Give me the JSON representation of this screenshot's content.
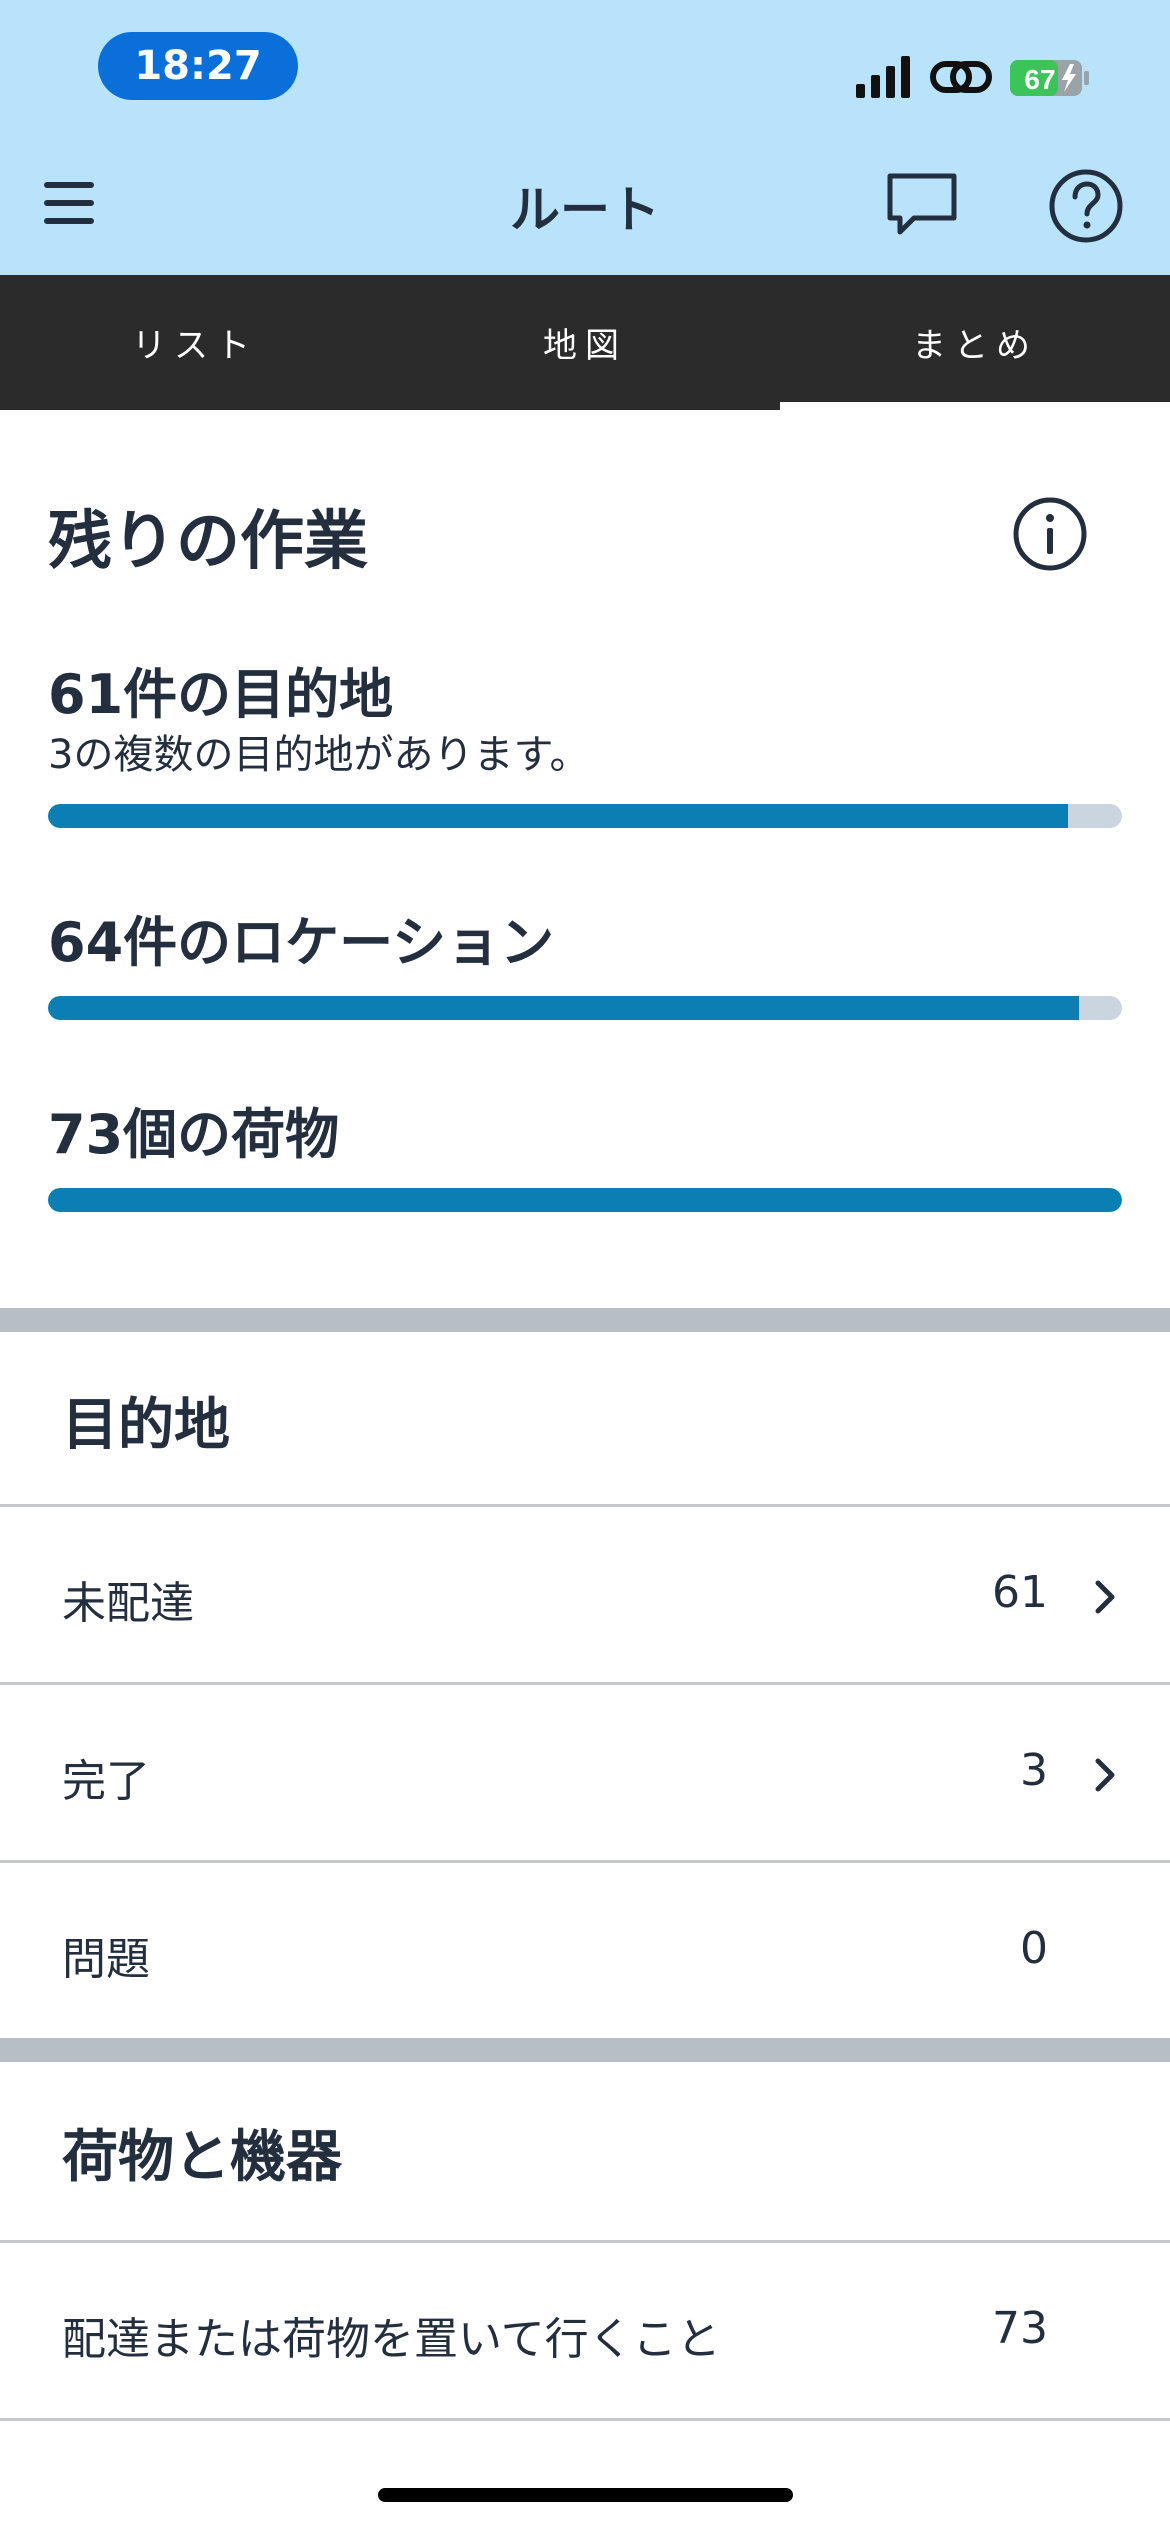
{
  "status_bar": {
    "time": "18:27",
    "battery": "67",
    "icons": [
      "signal-icon",
      "link-icon",
      "battery-icon"
    ]
  },
  "nav": {
    "title": "ルート",
    "icons": [
      "menu-icon",
      "chat-icon",
      "help-icon"
    ]
  },
  "tabs": [
    {
      "label": "リスト",
      "active": false
    },
    {
      "label": "地図",
      "active": false
    },
    {
      "label": "まとめ",
      "active": true
    }
  ],
  "remaining_work": {
    "title": "残りの作業",
    "metrics": [
      {
        "title": "61件の目的地",
        "subtitle": "3の複数の目的地があります。",
        "progress": 0.95
      },
      {
        "title": "64件のロケーション",
        "subtitle": "",
        "progress": 0.96
      },
      {
        "title": "73個の荷物",
        "subtitle": "",
        "progress": 1.0
      }
    ]
  },
  "destinations": {
    "title": "目的地",
    "rows": [
      {
        "label": "未配達",
        "count": "61",
        "has_chevron": true
      },
      {
        "label": "完了",
        "count": "3",
        "has_chevron": true
      },
      {
        "label": "問題",
        "count": "0",
        "has_chevron": false
      }
    ]
  },
  "packages": {
    "title": "荷物と機器",
    "rows": [
      {
        "label": "配達または荷物を置いて行くこと",
        "count": "73",
        "has_chevron": false
      }
    ]
  },
  "colors": {
    "header_bg": "#b9e3fb",
    "tab_bg": "#2b2b2b",
    "progress_fill": "#0b7fb3",
    "progress_track": "#cbd5e0",
    "time_pill": "#0a6fd8",
    "battery": "#3cc45a"
  }
}
